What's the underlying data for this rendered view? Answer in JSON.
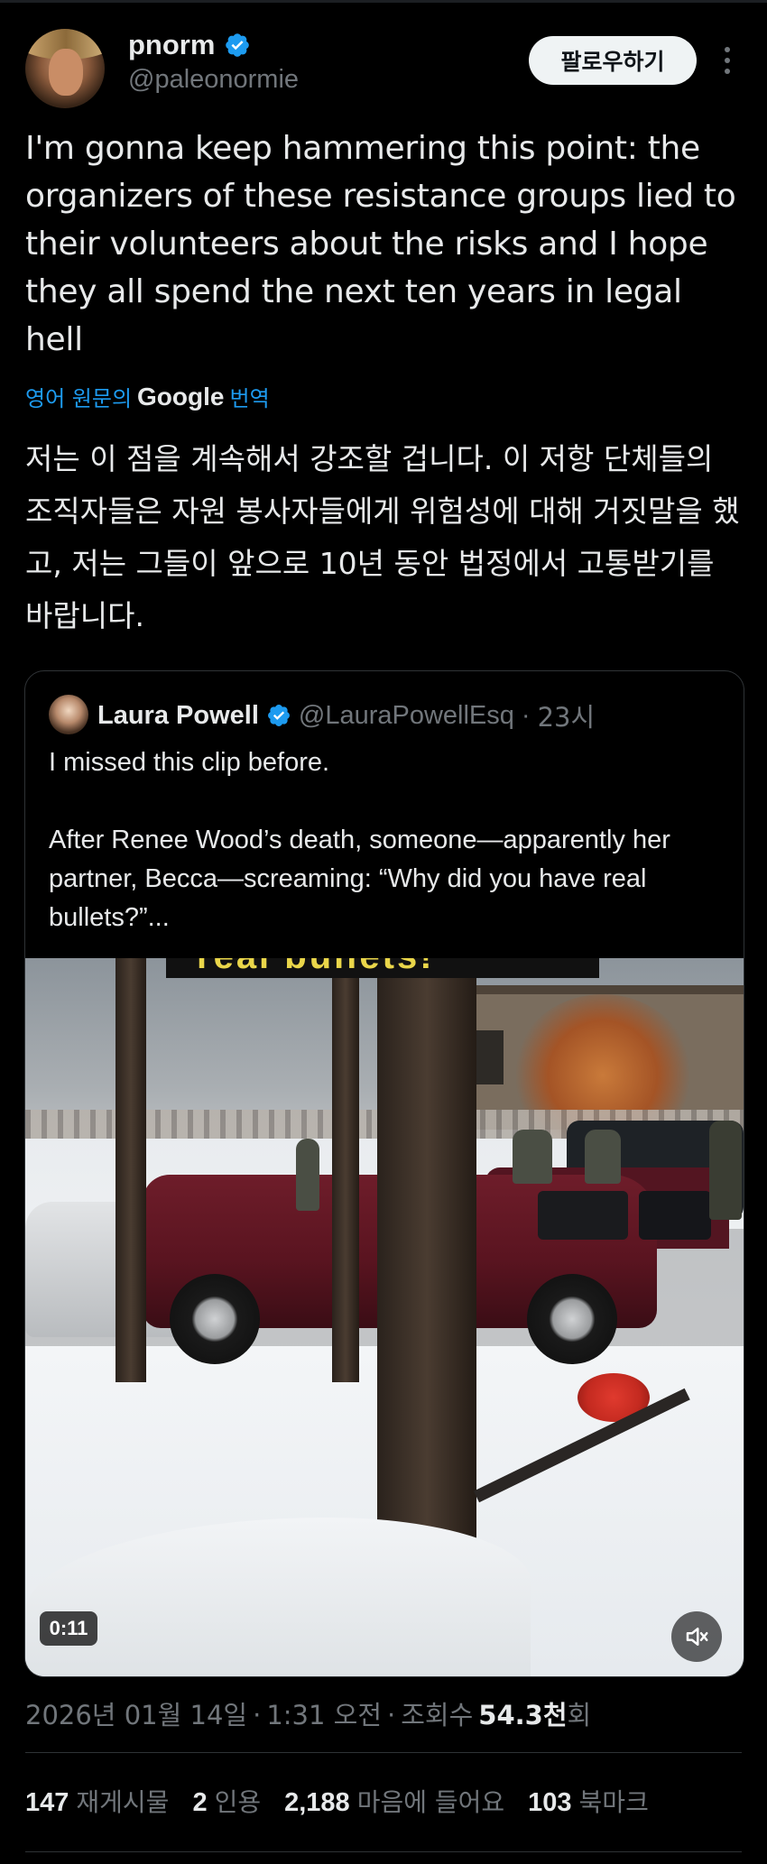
{
  "author": {
    "display_name": "pnorm",
    "handle": "@paleonormie"
  },
  "follow_label": "팔로우하기",
  "tweet_text": "I'm gonna keep hammering this point: the organizers of these resistance groups lied to their volunteers about the risks and I hope they all spend the next ten years in legal hell",
  "translation": {
    "label": "영어 원문의",
    "provider": "Google",
    "action": "번역",
    "text": "저는 이 점을 계속해서 강조할 겁니다. 이 저항 단체들의 조직자들은 자원 봉사자들에게 위험성에 대해 거짓말을 했고, 저는 그들이 앞으로 10년 동안 법정에서 고통받기를 바랍니다."
  },
  "quoted": {
    "display_name": "Laura Powell",
    "handle": "@LauraPowellEsq",
    "separator": "·",
    "time": "23시",
    "text": "I missed this clip before.\n\nAfter Renee Wood’s death, someone—apparently her partner, Becca—screaming: “Why did you have real bullets?”...",
    "video": {
      "caption": "real bullets!",
      "duration": "0:11"
    }
  },
  "meta": {
    "date": "2026년 01월 14일",
    "sep1": "·",
    "time": "1:31 오전",
    "sep2": "·",
    "views_label": "조회수",
    "views_value": "54.3천",
    "views_suffix": "회"
  },
  "stats": [
    {
      "value": "147",
      "label": "재게시물"
    },
    {
      "value": "2",
      "label": "인용"
    },
    {
      "value": "2,188",
      "label": "마음에 들어요"
    },
    {
      "value": "103",
      "label": "북마크"
    }
  ],
  "colors": {
    "background": "#000000",
    "text": "#e7e9ea",
    "secondary": "#71767b",
    "accent": "#1d9bf0",
    "verified": "#1d9bf0"
  },
  "icons": [
    "verified-badge-icon",
    "more-options-icon",
    "mute-icon"
  ]
}
